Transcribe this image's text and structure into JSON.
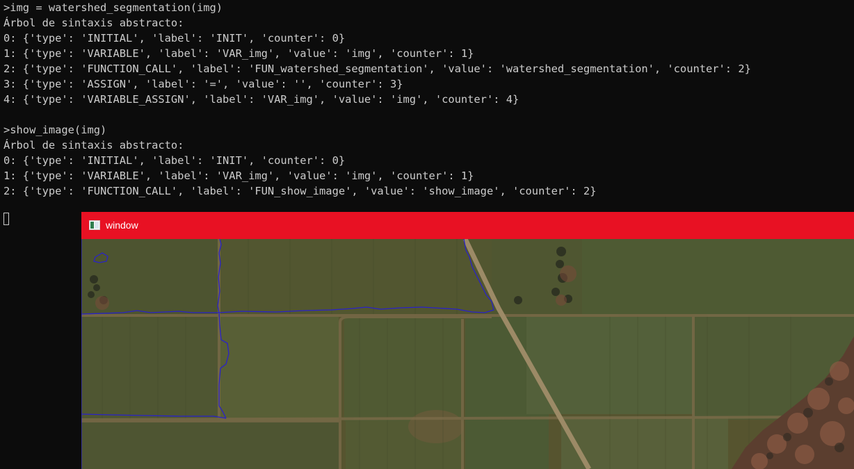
{
  "console": {
    "lines": [
      ">img = watershed_segmentation(img)",
      "Árbol de sintaxis abstracto:",
      "0: {'type': 'INITIAL', 'label': 'INIT', 'counter': 0}",
      "1: {'type': 'VARIABLE', 'label': 'VAR_img', 'value': 'img', 'counter': 1}",
      "2: {'type': 'FUNCTION_CALL', 'label': 'FUN_watershed_segmentation', 'value': 'watershed_segmentation', 'counter': 2}",
      "3: {'type': 'ASSIGN', 'label': '=', 'value': '', 'counter': 3}",
      "4: {'type': 'VARIABLE_ASSIGN', 'label': 'VAR_img', 'value': 'img', 'counter': 4}",
      "",
      ">show_image(img)",
      "Árbol de sintaxis abstracto:",
      "0: {'type': 'INITIAL', 'label': 'INIT', 'counter': 0}",
      "1: {'type': 'VARIABLE', 'label': 'VAR_img', 'value': 'img', 'counter': 1}",
      "2: {'type': 'FUNCTION_CALL', 'label': 'FUN_show_image', 'value': 'show_image', 'counter': 2}"
    ]
  },
  "window": {
    "title": "window",
    "icon": "image-window-icon",
    "titlebar_color": "#e81123",
    "segmentation_line_color": "#2a22c8"
  }
}
